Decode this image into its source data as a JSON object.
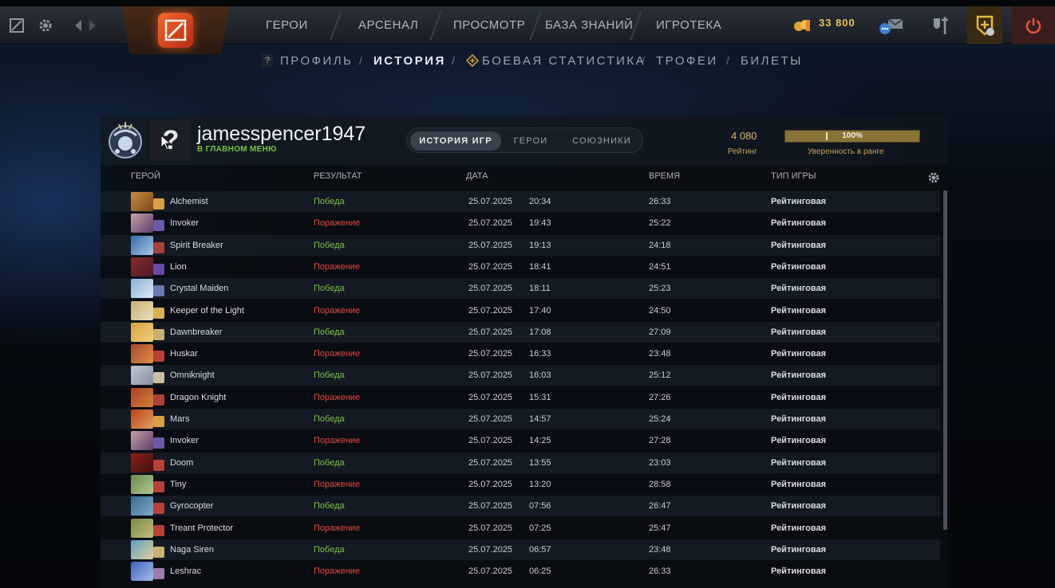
{
  "topbar": {
    "nav": [
      "ГЕРОИ",
      "АРСЕНАЛ",
      "ПРОСМОТР",
      "БАЗА ЗНАНИЙ",
      "ИГРОТЕКА"
    ],
    "gold": "33 800"
  },
  "subnav": {
    "items": [
      "ПРОФИЛЬ",
      "ИСТОРИЯ",
      "БОЕВАЯ СТАТИСТИКА",
      "ТРОФЕИ",
      "БИЛЕТЫ"
    ],
    "active": "ИСТОРИЯ",
    "profile_badge": "?"
  },
  "profile": {
    "avatar_text": "?",
    "username": "jamesspencer1947",
    "status": "В ГЛАВНОМ МЕНЮ",
    "tabs": [
      "ИСТОРИЯ ИГР",
      "ГЕРОИ",
      "СОЮЗНИКИ"
    ],
    "rating_value": "4 080",
    "rating_label": "Рейтинг",
    "confidence_pct": "100%",
    "confidence_fraction": 1.0,
    "confidence_label": "Уверенность в ранге"
  },
  "table": {
    "headers": [
      "ГЕРОЙ",
      "РЕЗУЛЬТАТ",
      "ДАТА",
      "ВРЕМЯ",
      "ТИП ИГРЫ"
    ],
    "rows": [
      {
        "hero": "Alchemist",
        "result": "Победа",
        "win": true,
        "date": "25.07.2025",
        "time": "20:34",
        "duration": "26:33",
        "type": "Рейтинговая"
      },
      {
        "hero": "Invoker",
        "result": "Поражение",
        "win": false,
        "date": "25.07.2025",
        "time": "19:43",
        "duration": "25:22",
        "type": "Рейтинговая"
      },
      {
        "hero": "Spirit Breaker",
        "result": "Победа",
        "win": true,
        "date": "25.07.2025",
        "time": "19:13",
        "duration": "24:18",
        "type": "Рейтинговая"
      },
      {
        "hero": "Lion",
        "result": "Поражение",
        "win": false,
        "date": "25.07.2025",
        "time": "18:41",
        "duration": "24:51",
        "type": "Рейтинговая"
      },
      {
        "hero": "Crystal Maiden",
        "result": "Победа",
        "win": true,
        "date": "25.07.2025",
        "time": "18:11",
        "duration": "25:23",
        "type": "Рейтинговая"
      },
      {
        "hero": "Keeper of the Light",
        "result": "Поражение",
        "win": false,
        "date": "25.07.2025",
        "time": "17:40",
        "duration": "24:50",
        "type": "Рейтинговая"
      },
      {
        "hero": "Dawnbreaker",
        "result": "Победа",
        "win": true,
        "date": "25.07.2025",
        "time": "17:08",
        "duration": "27:09",
        "type": "Рейтинговая"
      },
      {
        "hero": "Huskar",
        "result": "Поражение",
        "win": false,
        "date": "25.07.2025",
        "time": "16:33",
        "duration": "23:48",
        "type": "Рейтинговая"
      },
      {
        "hero": "Omniknight",
        "result": "Победа",
        "win": true,
        "date": "25.07.2025",
        "time": "16:03",
        "duration": "25:12",
        "type": "Рейтинговая"
      },
      {
        "hero": "Dragon Knight",
        "result": "Поражение",
        "win": false,
        "date": "25.07.2025",
        "time": "15:31",
        "duration": "27:26",
        "type": "Рейтинговая"
      },
      {
        "hero": "Mars",
        "result": "Победа",
        "win": true,
        "date": "25.07.2025",
        "time": "14:57",
        "duration": "25:24",
        "type": "Рейтинговая"
      },
      {
        "hero": "Invoker",
        "result": "Поражение",
        "win": false,
        "date": "25.07.2025",
        "time": "14:25",
        "duration": "27:28",
        "type": "Рейтинговая"
      },
      {
        "hero": "Doom",
        "result": "Победа",
        "win": true,
        "date": "25.07.2025",
        "time": "13:55",
        "duration": "23:03",
        "type": "Рейтинговая"
      },
      {
        "hero": "Tiny",
        "result": "Поражение",
        "win": false,
        "date": "25.07.2025",
        "time": "13:20",
        "duration": "28:58",
        "type": "Рейтинговая"
      },
      {
        "hero": "Gyrocopter",
        "result": "Победа",
        "win": true,
        "date": "25.07.2025",
        "time": "07:56",
        "duration": "26:47",
        "type": "Рейтинговая"
      },
      {
        "hero": "Treant Protector",
        "result": "Поражение",
        "win": false,
        "date": "25.07.2025",
        "time": "07:25",
        "duration": "25:47",
        "type": "Рейтинговая"
      },
      {
        "hero": "Naga Siren",
        "result": "Победа",
        "win": true,
        "date": "25.07.2025",
        "time": "06:57",
        "duration": "23:48",
        "type": "Рейтинговая"
      },
      {
        "hero": "Leshrac",
        "result": "Поражение",
        "win": false,
        "date": "25.07.2025",
        "time": "06:25",
        "duration": "26:33",
        "type": "Рейтинговая"
      }
    ]
  },
  "colors": {
    "win": "#7dc242",
    "loss": "#e0483a",
    "gold": "#e8c35a",
    "accent_orange": "#f26a2e"
  },
  "icons": [
    "dota-icon",
    "gear-icon",
    "back-arrow-icon",
    "forward-arrow-icon",
    "coins-icon",
    "chat-icon",
    "mail-icon",
    "armory-icon",
    "plus-shield-icon",
    "power-icon"
  ]
}
